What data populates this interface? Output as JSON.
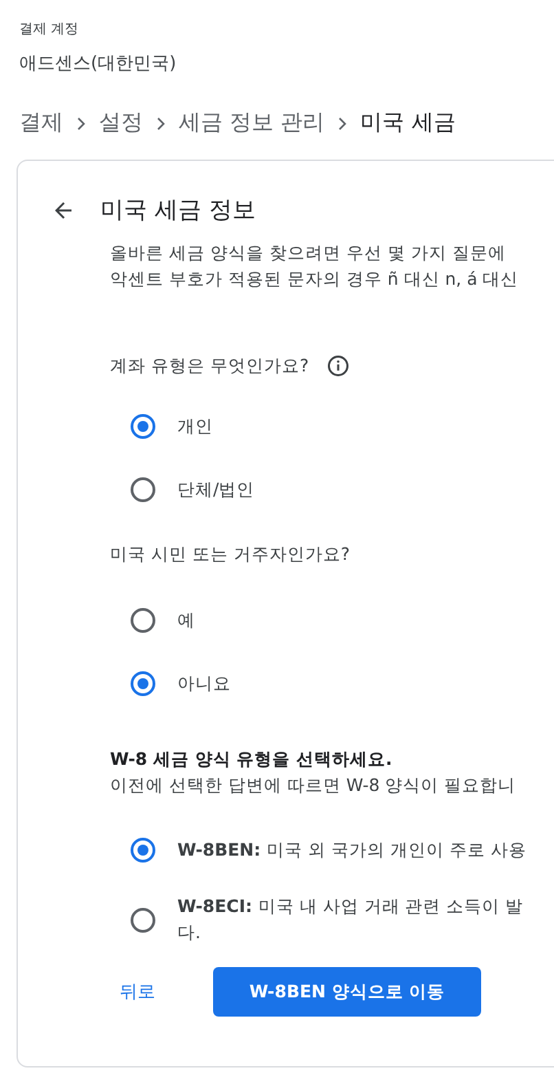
{
  "account": {
    "label": "결제 계정",
    "name": "애드센스(대한민국)"
  },
  "breadcrumb": [
    "결제",
    "설정",
    "세금 정보 관리",
    "미국 세금"
  ],
  "card": {
    "title": "미국 세금 정보",
    "intro": [
      "올바른 세금 양식을 찾으려면 우선 몇 가지 질문에",
      "악센트 부호가 적용된 문자의 경우 ñ 대신 n, á 대신"
    ],
    "questions": [
      {
        "label": "계좌 유형은 무엇인가요?",
        "info": true,
        "options": [
          {
            "label": "개인",
            "selected": true
          },
          {
            "label": "단체/법인",
            "selected": false
          }
        ]
      },
      {
        "label": "미국 시민 또는 거주자인가요?",
        "info": false,
        "options": [
          {
            "label": "예",
            "selected": false
          },
          {
            "label": "아니요",
            "selected": true
          }
        ]
      }
    ],
    "form_type": {
      "title": "W-8 세금 양식 유형을 선택하세요.",
      "subtitle": "이전에 선택한 답변에 따르면 W-8 양식이 필요합니",
      "options": [
        {
          "code": "W-8BEN:",
          "lines": [
            "미국 외 국가의 개인이 주로 사용"
          ],
          "selected": true
        },
        {
          "code": "W-8ECI:",
          "lines": [
            "미국 내 사업 거래 관련 소득이 발",
            "다."
          ],
          "selected": false
        }
      ]
    },
    "buttons": {
      "back": "뒤로",
      "primary": "W-8BEN 양식으로 이동"
    }
  }
}
